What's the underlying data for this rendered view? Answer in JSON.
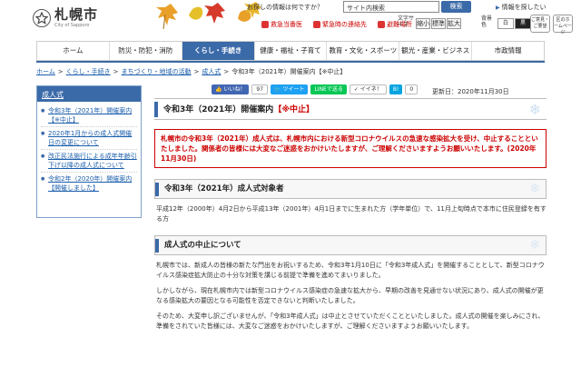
{
  "header": {
    "logo_text": "札幌市",
    "logo_sub": "City of Sapporo",
    "search_prompt": "お探しの情報は何ですか？",
    "search_value": "サイト内検索",
    "search_button": "検索",
    "help_link": "情報を探したい",
    "quick_links": [
      "救急当番医",
      "緊急時の連絡先",
      "避難場所"
    ],
    "font_size_label": "文字サイズ",
    "font_sizes": [
      "縮小",
      "標準",
      "拡大"
    ],
    "color_label": "背景色",
    "colors": [
      "白",
      "黒",
      "青"
    ],
    "side_buttons": [
      "ご意見・ご要望",
      "区のホームページ"
    ]
  },
  "nav": {
    "items": [
      "ホーム",
      "防災・防犯・消防",
      "くらし・手続き",
      "健康・福祉・子育て",
      "教育・文化・スポーツ",
      "観光・産業・ビジネス",
      "市政情報"
    ],
    "active_index": 2
  },
  "breadcrumb": [
    "ホーム",
    "くらし・手続き",
    "まちづくり・地域の活動",
    "成人式",
    "令和3年（2021年）開催案内【※中止】"
  ],
  "sidebar": {
    "title": "成人式",
    "items": [
      "令和3年（2021年）開催案内【※中止】",
      "2020年1月からの成人式開催日の変更について",
      "改正民法施行による成年年齢引下げ以降の成人式について",
      "令和2年（2020年）開催案内【開催しました】"
    ]
  },
  "social": {
    "facebook_like": "いいね！",
    "facebook_count": "97",
    "tweet": "ツイート",
    "line": "LINEで送る",
    "iine": "イイネ！",
    "hatena": "B!",
    "hatena_count": "0",
    "updated": "更新日：2020年11月30日"
  },
  "main": {
    "title_main": "令和3年（2021年）開催案内",
    "title_accent": "【※中止】",
    "notice": "札幌市の令和3年（2021年）成人式は、札幌市内における新型コロナウイルスの急速な感染拡大を受け、中止することといたしました。関係者の皆様には大変なご迷惑をおかけいたしますが、ご理解くださいますようお願いいたします。(2020年11月30日)",
    "section1_title": "令和3年（2021年）成人式対象者",
    "section1_text": "平成12年（2000年）4月2日から平成13年（2001年）4月1日までに生まれた方（学年単位）で、11月上旬時点で本市に住民登録を有する方",
    "section2_title": "成人式の中止について",
    "para1": "札幌市では、新成人の皆様の新たな門出をお祝いするため、令和3年1月10日に「令和3年成人式」を開催することとして、新型コロナウイルス感染症拡大防止の十分な対策を講じる前提で準備を進めてまいりました。",
    "para2": "しかしながら、現在札幌市内では新型コロナウイルス感染症の急速な拡大から、早期の改善を見通せない状況にあり、成人式の開催が更なる感染拡大の要因となる可能性を否定できないと判断いたしました。",
    "para3": "そのため、大変申し訳ございませんが、「令和3年成人式」は中止とさせていただくことといたしました。成人式の開催を楽しみにされ、準備をされていた皆様には、大変なご迷惑をおかけいたしますが、ご理解くださいますようお願いいたします。"
  }
}
